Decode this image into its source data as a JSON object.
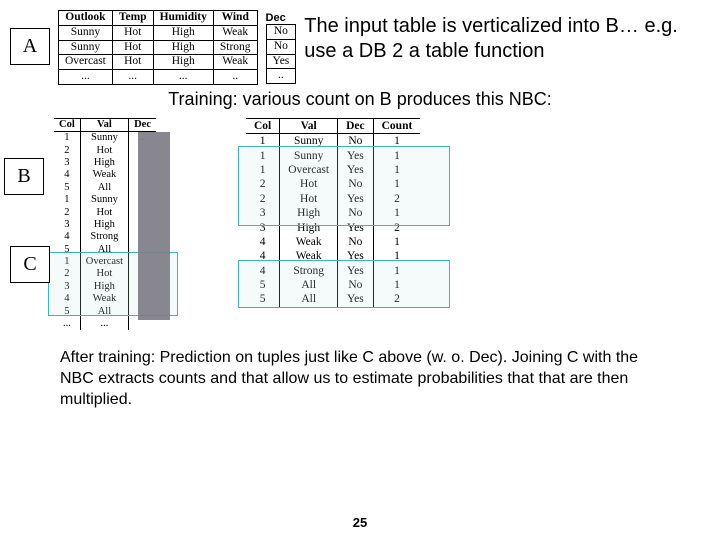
{
  "labels": {
    "A": "A",
    "B": "B",
    "C": "C",
    "dec": "Dec"
  },
  "desc": "The input table is verticalized into B… e.g. use a DB 2 a table function",
  "training_line": "Training: various count on B produces  this NBC:",
  "tableA": {
    "headers": [
      "Outlook",
      "Temp",
      "Humidity",
      "Wind"
    ],
    "rows": [
      [
        "Sunny",
        "Hot",
        "High",
        "Weak",
        "No"
      ],
      [
        "Sunny",
        "Hot",
        "High",
        "Strong",
        "No"
      ],
      [
        "Overcast",
        "Hot",
        "High",
        "Weak",
        "Yes"
      ],
      [
        "...",
        "...",
        "...",
        "..",
        ".."
      ]
    ]
  },
  "tableB": {
    "headers": [
      "Col",
      "Val",
      "Dec"
    ],
    "rows": [
      [
        "1",
        "Sunny",
        ".."
      ],
      [
        "2",
        "Hot",
        ""
      ],
      [
        "3",
        "High",
        ""
      ],
      [
        "4",
        "Weak",
        ""
      ],
      [
        "5",
        "All",
        ""
      ],
      [
        "1",
        "Sunny",
        ""
      ],
      [
        "2",
        "Hot",
        ""
      ],
      [
        "3",
        "High",
        ""
      ],
      [
        "4",
        "Strong",
        ""
      ],
      [
        "5",
        "All",
        ""
      ],
      [
        "1",
        "Overcast",
        ""
      ],
      [
        "2",
        "Hot",
        ""
      ],
      [
        "3",
        "High",
        ""
      ],
      [
        "4",
        "Weak",
        ""
      ],
      [
        "5",
        "All",
        ""
      ],
      [
        "...",
        "...",
        ""
      ]
    ]
  },
  "tableNBC": {
    "headers": [
      "Col",
      "Val",
      "Dec",
      "Count"
    ],
    "rows": [
      [
        "1",
        "Sunny",
        "No",
        "1"
      ],
      [
        "1",
        "Sunny",
        "Yes",
        "1"
      ],
      [
        "1",
        "Overcast",
        "Yes",
        "1"
      ],
      [
        "2",
        "Hot",
        "No",
        "1"
      ],
      [
        "2",
        "Hot",
        "Yes",
        "2"
      ],
      [
        "3",
        "High",
        "No",
        "1"
      ],
      [
        "3",
        "High",
        "Yes",
        "2"
      ],
      [
        "4",
        "Weak",
        "No",
        "1"
      ],
      [
        "4",
        "Weak",
        "Yes",
        "1"
      ],
      [
        "4",
        "Strong",
        "Yes",
        "1"
      ],
      [
        "5",
        "All",
        "No",
        "1"
      ],
      [
        "5",
        "All",
        "Yes",
        "2"
      ]
    ]
  },
  "after_text": "After training: Prediction on tuples just like C above (w. o. Dec). Joining C with the NBC extracts counts and that allow us to estimate probabilities that that are then multiplied.",
  "page_num": "25"
}
